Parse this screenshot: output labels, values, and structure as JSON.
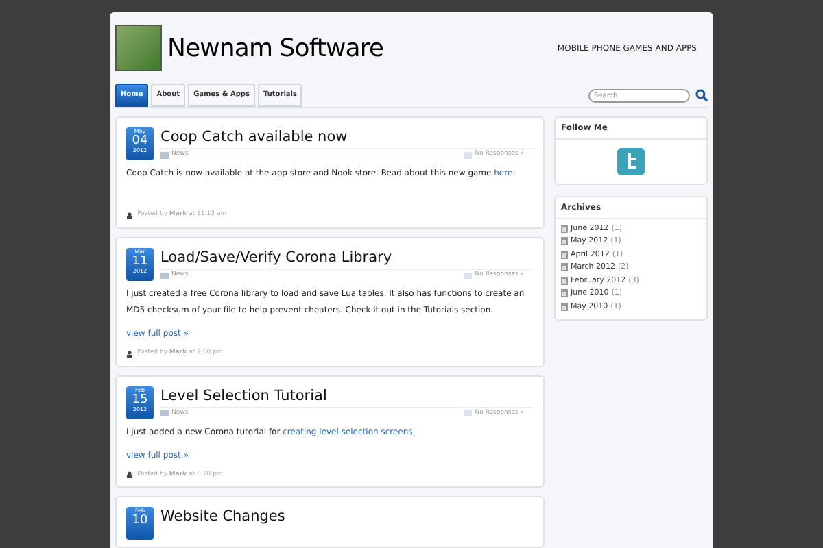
{
  "header": {
    "site_title": "Newnam Software",
    "tagline": "MOBILE PHONE GAMES AND APPS"
  },
  "nav": [
    {
      "label": "Home",
      "selected": true
    },
    {
      "label": "About",
      "selected": false
    },
    {
      "label": "Games & Apps",
      "selected": false
    },
    {
      "label": "Tutorials",
      "selected": false
    }
  ],
  "search": {
    "placeholder": "Search"
  },
  "posts": [
    {
      "month": "May",
      "day": "04",
      "year": "2012",
      "title": "Coop Catch available now",
      "category": "News",
      "responses": "No Responses »",
      "body": [
        {
          "text": "Coop Catch is now available at the app store and Nook store.  Read about this new game "
        },
        {
          "link": "here"
        },
        {
          "text": "."
        }
      ],
      "byline": "Posted by **Mark** at 11:13 am"
    },
    {
      "month": "Mar",
      "day": "11",
      "year": "2012",
      "title": "Load/Save/Verify Corona Library",
      "category": "News",
      "responses": "No Responses »",
      "body": [
        {
          "text": "I just created a free Corona library to load and save Lua tables. It also has functions to create an MD5 checksum of your file to help prevent cheaters. Check it out in the Tutorials section."
        }
      ],
      "more": "view full post »",
      "byline": "Posted by **Mark** at 2:50 pm"
    },
    {
      "month": "Feb",
      "day": "15",
      "year": "2012",
      "title": "Level Selection Tutorial",
      "category": "News",
      "responses": "No Responses »",
      "body": [
        {
          "text": "I just added a new Corona tutorial for "
        },
        {
          "link": "creating level selection screens"
        },
        {
          "text": "."
        }
      ],
      "more": "view full post »",
      "byline": "Posted by **Mark** at 6:28 pm"
    },
    {
      "month": "Feb",
      "day": "10",
      "title": "Website Changes"
    }
  ],
  "sidebar": {
    "follow": {
      "title": "Follow Me"
    },
    "archives": {
      "title": "Archives",
      "items": [
        {
          "label": "June 2012",
          "count": "(1)"
        },
        {
          "label": "May 2012",
          "count": "(1)"
        },
        {
          "label": "April 2012",
          "count": "(1)"
        },
        {
          "label": "March 2012",
          "count": "(2)"
        },
        {
          "label": "February 2012",
          "count": "(3)"
        },
        {
          "label": "June 2010",
          "count": "(1)"
        },
        {
          "label": "May 2010",
          "count": "(1)"
        }
      ]
    }
  }
}
